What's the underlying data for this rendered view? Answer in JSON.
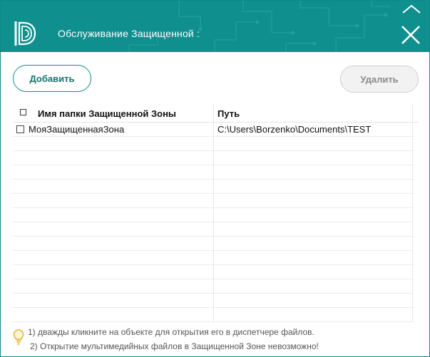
{
  "window": {
    "title": "Обслуживание Защищенной :"
  },
  "toolbar": {
    "add_label": "Добавить",
    "delete_label": "Удалить"
  },
  "table": {
    "columns": [
      "Имя папки Защищенной Зоны",
      "Путь"
    ],
    "rows": [
      {
        "name": "МояЗащищеннаяЗона",
        "path": "C:\\Users\\Borzenko\\Documents\\TEST",
        "checked": false
      }
    ]
  },
  "hints": [
    "1) дважды кликните на объекте для открытия его в диспетчере файлов.",
    "2) Открытие мультимедийных файлов в Защищенной Зоне невозможно!"
  ],
  "colors": {
    "accent": "#0f8f8e",
    "button_text": "#14706f",
    "hint_icon": "#e8b632"
  },
  "icons": {
    "logo": "app-logo-d",
    "close": "close-icon",
    "hint": "lightbulb-icon"
  }
}
